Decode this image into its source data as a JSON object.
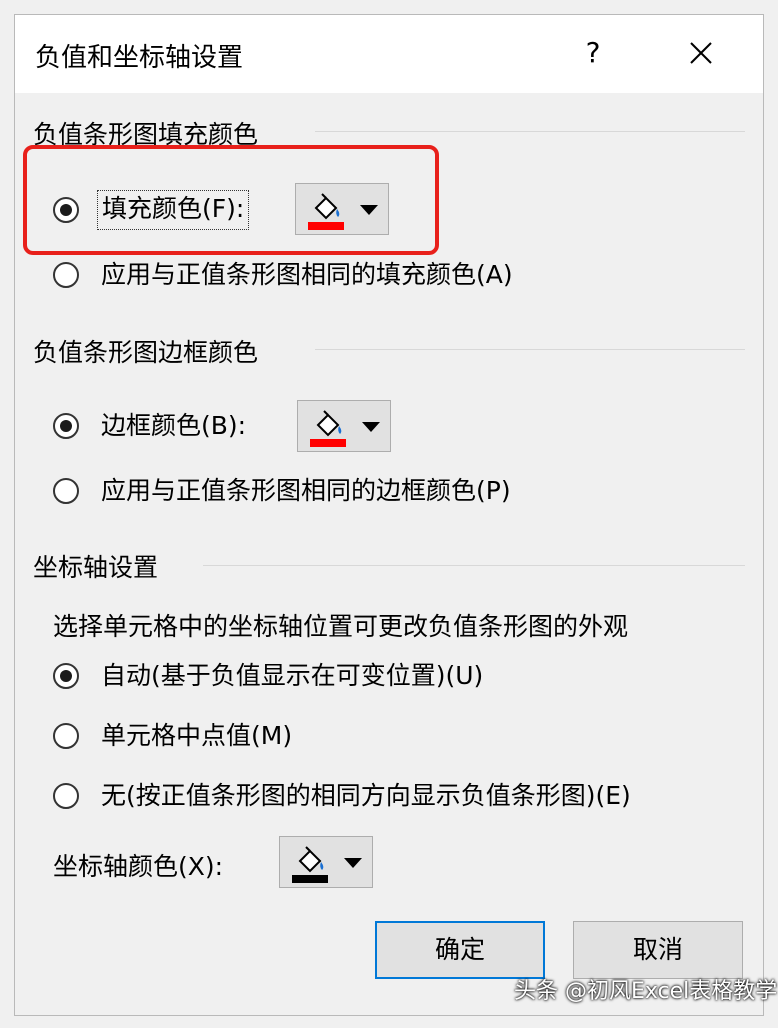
{
  "window": {
    "title": "负值和坐标轴设置",
    "help_label": "?",
    "close_icon": "close-icon"
  },
  "fill_section": {
    "title": "负值条形图填充颜色",
    "option_fill": "填充颜色(F):",
    "option_fill_selected": true,
    "option_same": "应用与正值条形图相同的填充颜色(A)",
    "fill_color": "#ff0000"
  },
  "border_section": {
    "title": "负值条形图边框颜色",
    "option_border": "边框颜色(B):",
    "option_border_selected": true,
    "option_same": "应用与正值条形图相同的边框颜色(P)",
    "border_color": "#ff0000"
  },
  "axis_section": {
    "title": "坐标轴设置",
    "description": "选择单元格中的坐标轴位置可更改负值条形图的外观",
    "option_auto": "自动(基于负值显示在可变位置)(U)",
    "option_auto_selected": true,
    "option_midpoint": "单元格中点值(M)",
    "option_none": "无(按正值条形图的相同方向显示负值条形图)(E)",
    "axis_color_label": "坐标轴颜色(X):",
    "axis_color": "#000000"
  },
  "buttons": {
    "ok": "确定",
    "cancel": "取消"
  },
  "highlight_color": "#e8201b",
  "watermark": "头条 @初风Excel表格教学"
}
